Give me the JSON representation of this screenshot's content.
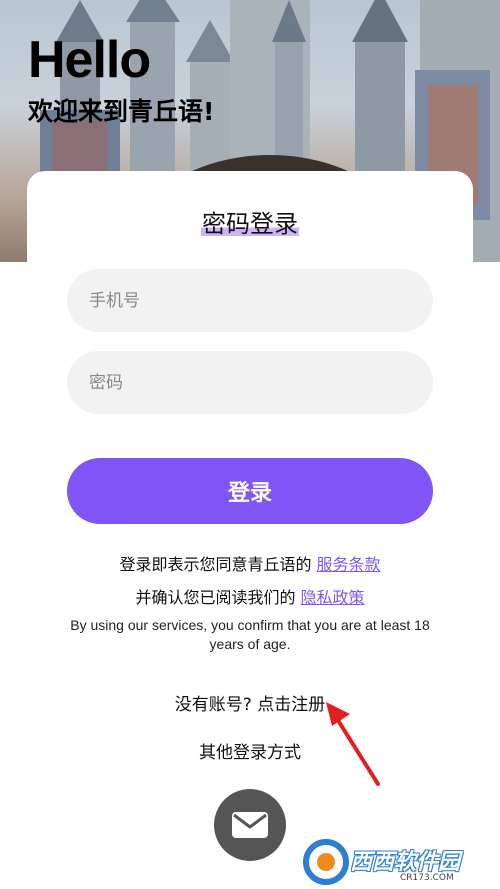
{
  "header": {
    "greeting": "Hello",
    "welcome": "欢迎来到青丘语!"
  },
  "login": {
    "title": "密码登录",
    "phone_placeholder": "手机号",
    "password_placeholder": "密码",
    "submit_label": "登录"
  },
  "terms": {
    "line1_prefix": "登录即表示您同意青丘语的",
    "service_link": "服务条款",
    "line2_prefix": "并确认您已阅读我们的",
    "privacy_link": "隐私政策",
    "age_note": "By using our services, you confirm that you are at least 18 years of age."
  },
  "register": {
    "prompt": "没有账号?",
    "link": "点击注册"
  },
  "other_login": {
    "label": "其他登录方式",
    "icons": [
      "mail-icon"
    ]
  },
  "watermark": {
    "brand": "西西软件园",
    "url": "CR173.COM"
  },
  "colors": {
    "accent": "#7f55f5",
    "field_bg": "#f2f2f2",
    "mail_button": "#555555",
    "arrow": "#e02020"
  }
}
